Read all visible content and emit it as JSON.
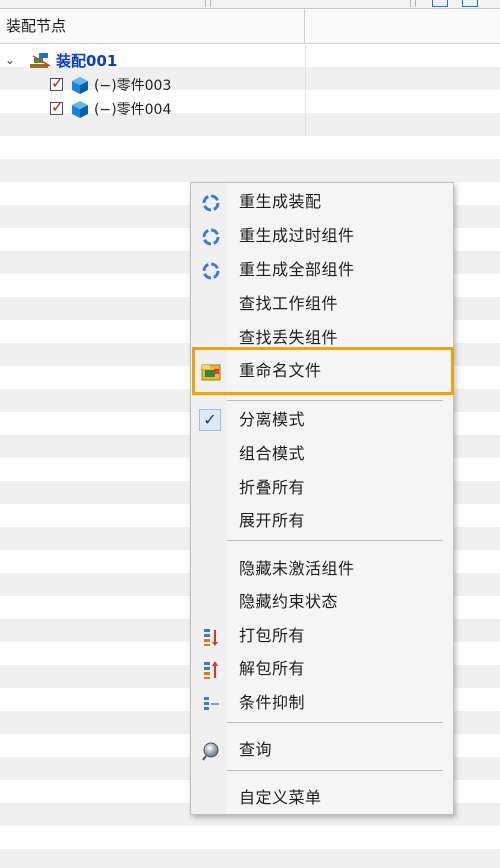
{
  "tree": {
    "column_header": "装配节点",
    "expander": "⌄",
    "assembly": {
      "label": "装配001"
    },
    "parts": [
      {
        "label": "(−)零件003",
        "check": "✓"
      },
      {
        "label": "(−)零件004",
        "check": "✓"
      }
    ]
  },
  "menu": {
    "items": [
      {
        "label": "重生成装配",
        "icon": "regen-icon"
      },
      {
        "label": "重生成过时组件",
        "icon": "regen-icon"
      },
      {
        "label": "重生成全部组件",
        "icon": "regen-icon"
      },
      {
        "label": "查找工作组件"
      },
      {
        "label": "查找丢失组件"
      },
      {
        "label": "重命名文件",
        "icon": "rename-file-icon"
      },
      {
        "label": "分离模式",
        "checked_glyph": "✓"
      },
      {
        "label": "组合模式"
      },
      {
        "label": "折叠所有"
      },
      {
        "label": "展开所有"
      },
      {
        "label": "隐藏未激活组件"
      },
      {
        "label": "隐藏约束状态"
      },
      {
        "label": "打包所有",
        "icon": "pack-icon"
      },
      {
        "label": "解包所有",
        "icon": "unpack-icon"
      },
      {
        "label": "条件抑制",
        "icon": "suppress-icon"
      },
      {
        "label": "查询",
        "icon": "query-icon"
      },
      {
        "label": "自定义菜单"
      }
    ]
  },
  "colors": {
    "assembly_label": "#0b3ccf",
    "highlight_border": "#f2a20d",
    "check_red": "#d21414"
  }
}
